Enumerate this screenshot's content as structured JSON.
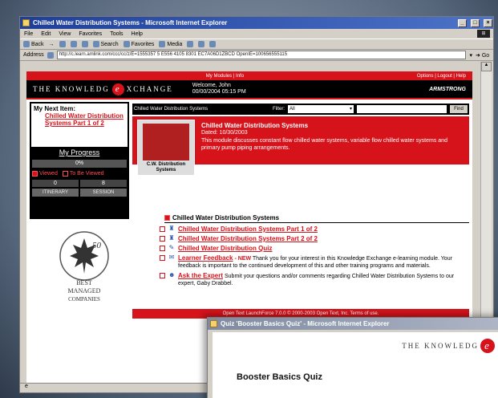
{
  "window": {
    "title": "Chilled Water Distribution Systems - Microsoft Internet Explorer",
    "menus": [
      "File",
      "Edit",
      "View",
      "Favorites",
      "Tools",
      "Help"
    ],
    "toolbar": [
      "Back",
      "Search",
      "Favorites",
      "Media"
    ],
    "address_label": "Address",
    "address": "http://c.learn.amlink.com/ccc/cc/z/E=1555357 5 E556 4105 8301 EC7A06D1ZBCD OpenIE=100656555115",
    "go_label": "Go",
    "status_text": "e"
  },
  "site": {
    "top_links_center": "My Modules | Info",
    "top_links_right": "Options | Logout | Help",
    "brand_left": "THE KNOWLEDG",
    "brand_e": "e",
    "brand_right": "XCHANGE",
    "welcome_line1": "Welcome, John",
    "welcome_line2": "00/00/2004 05:15 PM",
    "partner": "ARMSTRONG"
  },
  "left": {
    "next_item_label": "My Next Item:",
    "next_item_link": "Chilled Water Distribution Systems Part 1 of 2",
    "progress_title": "My Progress",
    "progress_value": "0%",
    "legend_viewed": "Viewed",
    "legend_tobe": "To Be Viewed",
    "count_viewed": "0",
    "count_tobe": "8",
    "btn_left": "ITINERARY",
    "btn_right": "SESSION"
  },
  "filter": {
    "context": "Chilled Water Distribution Systems",
    "filter_label": "Filter:",
    "filter_value": "All",
    "find_label": "Find"
  },
  "module": {
    "thumb_caption": "C.W. Distribution Systems",
    "title": "Chilled Water Distribution Systems",
    "date": "Dated: 10/30/2003",
    "description": "This module discusses constant flow chilled water systems, variable flow chilled water systems and primary pump piping arrangements."
  },
  "section": {
    "title": "Chilled Water Distribution Systems",
    "items": [
      {
        "link": "Chilled Water Distribution Systems Part 1 of 2",
        "text": ""
      },
      {
        "link": "Chilled Water Distribution Systems Part 2 of 2",
        "text": ""
      },
      {
        "link": "Chilled Water Distribution Quiz",
        "text": ""
      },
      {
        "link": "Learner Feedback",
        "tag": "- NEW",
        "text": "Thank you for your interest in this Knowledge Exchange e-learning module. Your feedback is important to the continued development of this and other training programs and materials."
      },
      {
        "link": "Ask the Expert",
        "text": "Submit your questions and/or comments regarding Chilled Water Distribution Systems to our expert, Gaby Drabbel."
      }
    ]
  },
  "seal": {
    "number": "50",
    "line1": "BEST",
    "line2": "MANAGED",
    "line3": "COMPANIES"
  },
  "footer": "Open Text LaunchForce 7.0.0 © 2000-2003 Open Text, Inc. Terms of use.",
  "quiz_window": {
    "title": "Quiz 'Booster Basics Quiz' - Microsoft Internet Explorer",
    "brand": "THE KNOWLEDG",
    "brand_e": "e",
    "heading": "Booster Basics Quiz"
  }
}
